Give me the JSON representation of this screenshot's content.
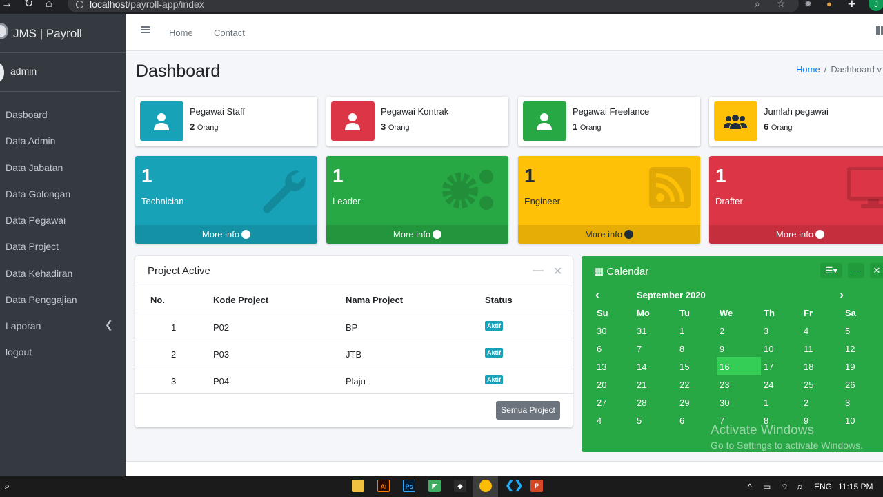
{
  "browser": {
    "url_host": "localhost",
    "url_path": "/payroll-app/index",
    "profile_initial": "J"
  },
  "brand": {
    "name": "JMS | Payroll"
  },
  "user": {
    "name": "admin"
  },
  "sidebar": {
    "items": [
      {
        "label": "Dasboard"
      },
      {
        "label": "Data Admin"
      },
      {
        "label": "Data Jabatan"
      },
      {
        "label": "Data Golongan"
      },
      {
        "label": "Data Pegawai"
      },
      {
        "label": "Data Project"
      },
      {
        "label": "Data Kehadiran"
      },
      {
        "label": "Data Penggajian"
      },
      {
        "label": "Laporan"
      },
      {
        "label": "logout"
      }
    ]
  },
  "topnav": {
    "home": "Home",
    "contact": "Contact"
  },
  "page": {
    "title": "Dashboard",
    "breadcrumb_home": "Home",
    "breadcrumb_sep": "/",
    "breadcrumb_current": "Dashboard v"
  },
  "info_boxes": [
    {
      "title": "Pegawai Staff",
      "count": "2",
      "unit": "Orang",
      "color": "#17a2b8"
    },
    {
      "title": "Pegawai Kontrak",
      "count": "3",
      "unit": "Orang",
      "color": "#dc3545"
    },
    {
      "title": "Pegawai Freelance",
      "count": "1",
      "unit": "Orang",
      "color": "#28a745"
    },
    {
      "title": "Jumlah pegawai",
      "count": "6",
      "unit": "Orang",
      "color": "#ffc107"
    }
  ],
  "small_boxes": [
    {
      "count": "1",
      "label": "Technician",
      "footer": "More info",
      "color": "#17a2b8",
      "icon": "wrench-icon"
    },
    {
      "count": "1",
      "label": "Leader",
      "footer": "More info",
      "color": "#28a745",
      "icon": "cogs-icon"
    },
    {
      "count": "1",
      "label": "Engineer",
      "footer": "More info",
      "color": "#ffc107",
      "icon": "rss-icon"
    },
    {
      "count": "1",
      "label": "Drafter",
      "footer": "More info",
      "color": "#dc3545",
      "icon": "desktop-icon"
    }
  ],
  "project_card": {
    "title": "Project Active",
    "headers": [
      "No.",
      "Kode Project",
      "Nama Project",
      "Status"
    ],
    "rows": [
      {
        "no": "1",
        "kode": "P02",
        "nama": "BP",
        "status": "Aktif"
      },
      {
        "no": "2",
        "kode": "P03",
        "nama": "JTB",
        "status": "Aktif"
      },
      {
        "no": "3",
        "kode": "P04",
        "nama": "Plaju",
        "status": "Aktif"
      }
    ],
    "button": "Semua Project"
  },
  "calendar": {
    "title": "Calendar",
    "month": "September 2020",
    "weekdays": [
      "Su",
      "Mo",
      "Tu",
      "We",
      "Th",
      "Fr",
      "Sa"
    ],
    "weeks": [
      [
        "30",
        "31",
        "1",
        "2",
        "3",
        "4",
        "5"
      ],
      [
        "6",
        "7",
        "8",
        "9",
        "10",
        "11",
        "12"
      ],
      [
        "13",
        "14",
        "15",
        "16",
        "17",
        "18",
        "19"
      ],
      [
        "20",
        "21",
        "22",
        "23",
        "24",
        "25",
        "26"
      ],
      [
        "27",
        "28",
        "29",
        "30",
        "1",
        "2",
        "3"
      ],
      [
        "4",
        "5",
        "6",
        "7",
        "8",
        "9",
        "10"
      ]
    ],
    "today": "16"
  },
  "watermark": {
    "line1": "Activate Windows",
    "line2": "Go to Settings to activate Windows."
  },
  "taskbar": {
    "lang": "ENG",
    "time": "11:15 PM"
  }
}
